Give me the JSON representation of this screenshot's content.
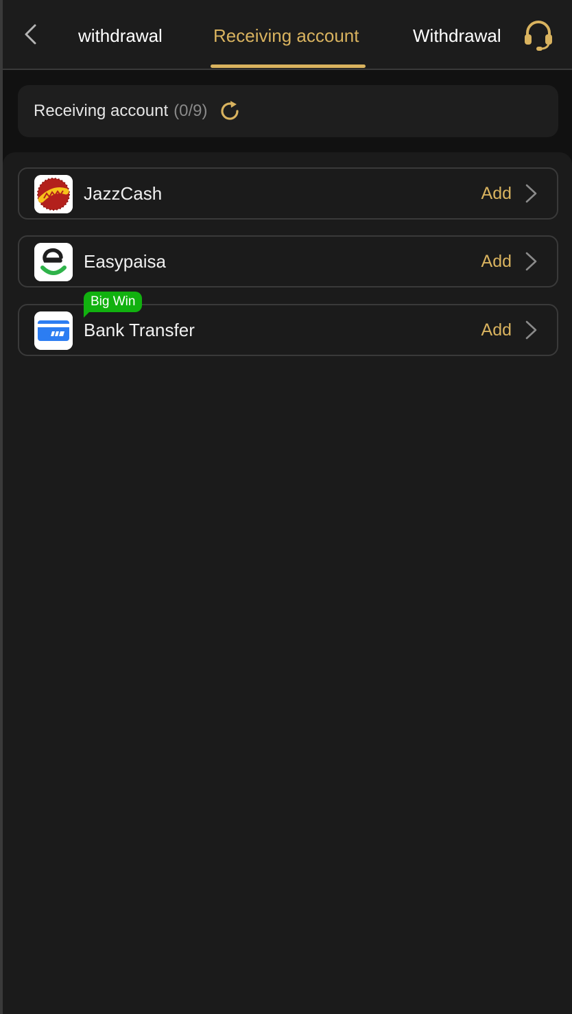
{
  "header": {
    "tabs": [
      {
        "label": "withdrawal",
        "active": false
      },
      {
        "label": "Receiving account",
        "active": true
      },
      {
        "label": "Withdrawal",
        "active": false
      }
    ],
    "back_icon": "chevron-left-icon",
    "support_icon": "headset-icon"
  },
  "summary": {
    "label": "Receiving account",
    "count": "(0/9)",
    "refresh_icon": "refresh-icon"
  },
  "accounts": [
    {
      "name": "JazzCash",
      "action": "Add",
      "icon": "jazzcash-logo",
      "badge": null
    },
    {
      "name": "Easypaisa",
      "action": "Add",
      "icon": "easypaisa-logo",
      "badge": null
    },
    {
      "name": "Bank Transfer",
      "action": "Add",
      "icon": "bank-card-icon",
      "badge": "Big Win"
    }
  ],
  "colors": {
    "accent": "#d9b35f",
    "badge": "#11b10f",
    "background": "#1b1b1b"
  }
}
